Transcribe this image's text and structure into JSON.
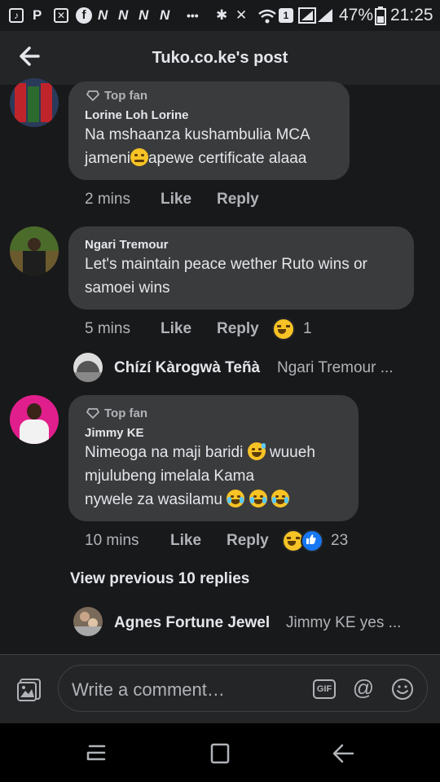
{
  "status_bar": {
    "battery": "47%",
    "time": "21:25",
    "sim": "1",
    "left_icons": [
      "tiktok-icon",
      "p-icon",
      "image-icon",
      "facebook-icon",
      "n-icon",
      "n-icon",
      "n-icon",
      "n-icon",
      "more-icon"
    ],
    "n_glyph": "N",
    "p_glyph": "P",
    "more_glyph": "•••"
  },
  "header": {
    "title": "Tuko.co.ke's post"
  },
  "comments": [
    {
      "badge": "Top fan",
      "author": "Lorine Loh Lorine",
      "text_line1": "Na mshaanza kushambulia MCA",
      "text_line2_a": "jameni",
      "text_line2_b": "apewe certificate alaaa",
      "time": "2 mins",
      "like": "Like",
      "reply": "Reply"
    },
    {
      "author": "Ngari Tremour",
      "text_line1": "Let's maintain peace wether Ruto wins or",
      "text_line2": "samoei wins",
      "time": "5 mins",
      "like": "Like",
      "reply": "Reply",
      "reaction_count": "1",
      "reply_preview": {
        "name": "Chízí Kàrogwà Teñà",
        "text": "Ngari Tremour ..."
      }
    },
    {
      "badge": "Top fan",
      "author": "Jimmy KE",
      "text_line1": "Nimeoga na maji baridi",
      "text_line1_b": "wuueh",
      "text_line2": "mjulubeng imelala Kama",
      "text_line3": "nywele za wasilamu",
      "time": "10 mins",
      "like": "Like",
      "reply": "Reply",
      "reaction_count": "23",
      "view_previous": "View previous 10 replies",
      "reply_preview": {
        "name": "Agnes Fortune Jewel",
        "text": "Jimmy KE yes ..."
      }
    }
  ],
  "composer": {
    "placeholder": "Write a comment…",
    "gif_label": "GIF",
    "mention_label": "@"
  },
  "colors": {
    "background": "#18191a",
    "bubble": "#3a3b3c",
    "header": "#242526",
    "like_blue": "#1877f2",
    "emoji_yellow": "#f7c325"
  }
}
